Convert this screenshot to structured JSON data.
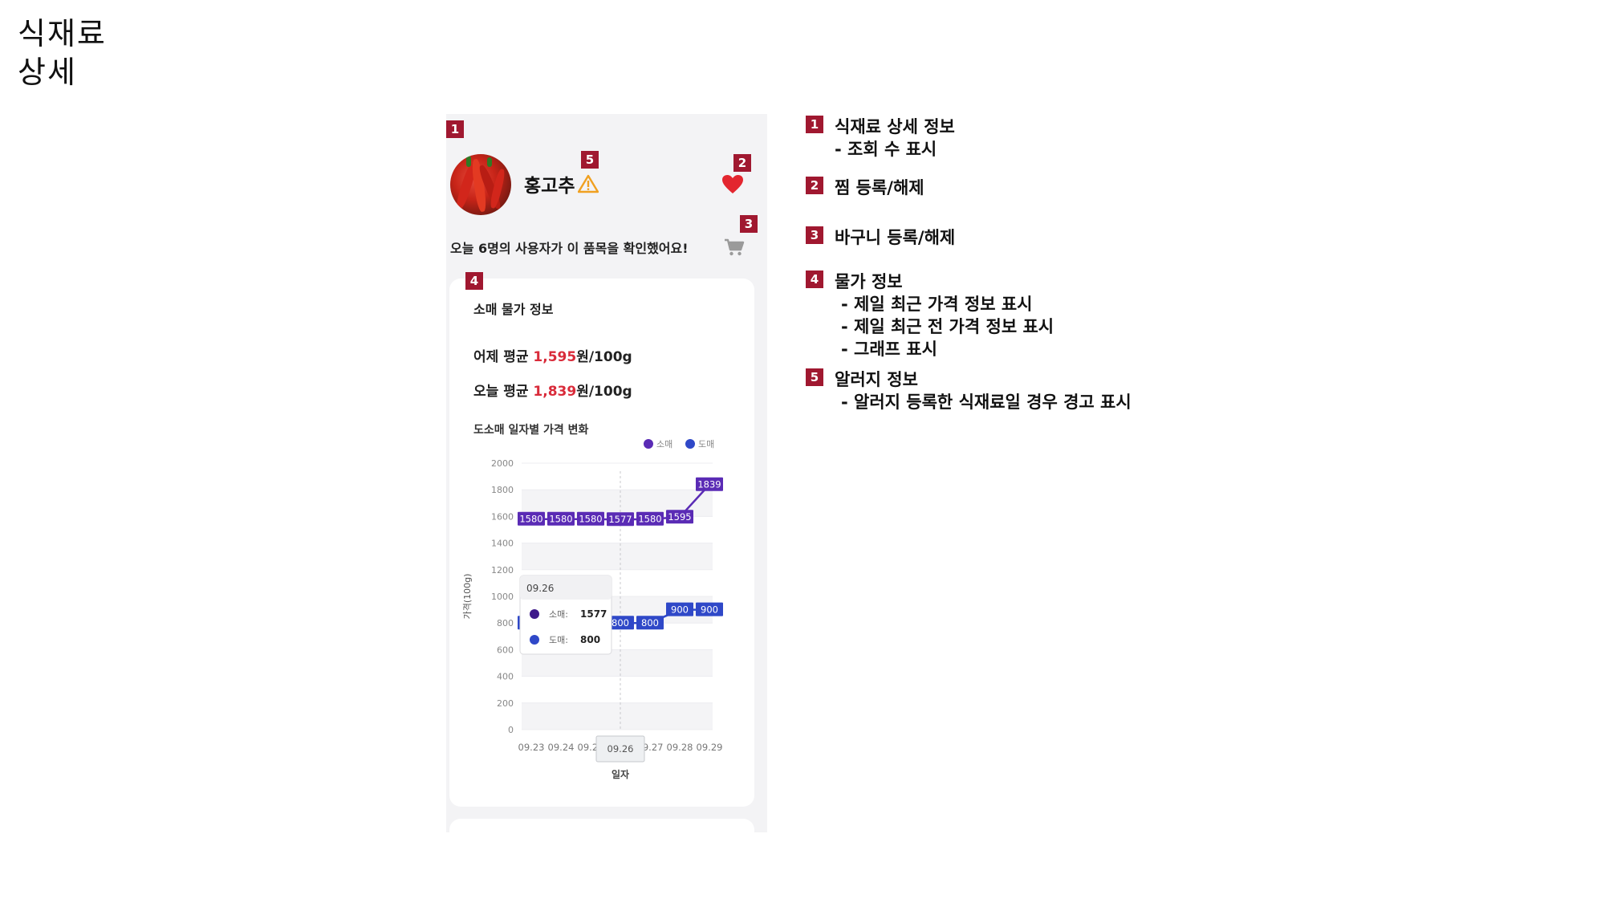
{
  "page": {
    "title_line1": "식재료",
    "title_line2": "상세"
  },
  "badges": {
    "b1": "1",
    "b2": "2",
    "b3": "3",
    "b4": "4",
    "b5": "5"
  },
  "item": {
    "name": "홍고추",
    "view_message": "오늘 6명의 사용자가 이 품목을 확인했어요!",
    "icons": {
      "avatar": "red-pepper-photo",
      "allergy": "warning-triangle-icon",
      "favorite": "heart-icon",
      "basket": "cart-icon"
    },
    "colors": {
      "heart": "#e3262f",
      "warning": "#f0a020",
      "badge": "#a01830"
    }
  },
  "price_card": {
    "heading": "소매 물가 정보",
    "yesterday_prefix": "어제 평균 ",
    "yesterday_value": "1,595",
    "yesterday_unit": "원/100g",
    "today_prefix": "오늘 평균 ",
    "today_value": "1,839",
    "today_unit": "원/100g",
    "accent_color": "#d92b3a"
  },
  "chart_data": {
    "type": "line",
    "title": "도소매 일자별 가격 변화",
    "xlabel": "일자",
    "ylabel": "가격(100g)",
    "categories": [
      "09.23",
      "09.24",
      "09.25",
      "09.26",
      "09.27",
      "09.28",
      "09.29"
    ],
    "ylim": [
      0,
      2000
    ],
    "yticks": [
      0,
      200,
      400,
      600,
      800,
      1000,
      1200,
      1400,
      1600,
      1800,
      2000
    ],
    "grid": "horizontal bands",
    "legend_position": "top-right",
    "series": [
      {
        "name": "소매",
        "color": "#5a2bb5",
        "values": [
          1580,
          1580,
          1580,
          1577,
          1580,
          1595,
          1839
        ]
      },
      {
        "name": "도매",
        "color": "#2f48c8",
        "values": [
          800,
          800,
          800,
          800,
          800,
          900,
          900
        ]
      }
    ],
    "tooltip": {
      "date": "09.26",
      "rows": [
        {
          "label": "소매:",
          "value": "1577",
          "color": "#3e1a8a"
        },
        {
          "label": "도매:",
          "value": "800",
          "color": "#2f48c8"
        }
      ]
    },
    "highlight_category": "09.26"
  },
  "notes": [
    {
      "title": "식재료 상세 정보",
      "subs": [
        "- 조회 수 표시"
      ]
    },
    {
      "title": "찜 등록/해제",
      "subs": []
    },
    {
      "title": "바구니 등록/해제",
      "subs": []
    },
    {
      "title": "물가 정보",
      "subs": [
        "- 제일 최근 가격 정보 표시",
        "- 제일 최근 전 가격 정보 표시",
        "- 그래프 표시"
      ]
    },
    {
      "title": "알러지 정보",
      "subs": [
        "- 알러지 등록한 식재료일 경우 경고 표시"
      ]
    }
  ]
}
